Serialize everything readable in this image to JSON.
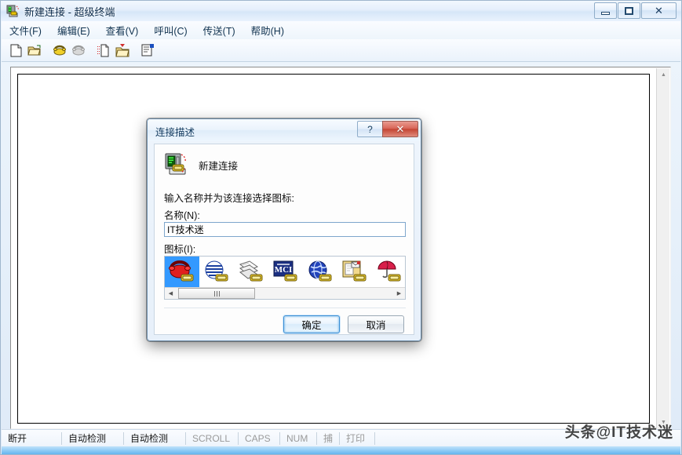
{
  "window": {
    "title": "新建连接 - 超级终端",
    "icon": "modem-phone-icon",
    "controls": {
      "minimize": "minimize-icon",
      "maximize": "maximize-icon",
      "close": "close-icon"
    }
  },
  "menubar": {
    "items": [
      {
        "label": "文件(F)",
        "name": "menu-file"
      },
      {
        "label": "编辑(E)",
        "name": "menu-edit"
      },
      {
        "label": "查看(V)",
        "name": "menu-view"
      },
      {
        "label": "呼叫(C)",
        "name": "menu-call"
      },
      {
        "label": "传送(T)",
        "name": "menu-transfer"
      },
      {
        "label": "帮助(H)",
        "name": "menu-help"
      }
    ]
  },
  "toolbar": {
    "buttons": [
      {
        "name": "new-connection-icon",
        "tip": "新建"
      },
      {
        "name": "open-folder-icon",
        "tip": "打开"
      },
      {
        "name": "call-phone-icon",
        "tip": "呼叫"
      },
      {
        "name": "hangup-phone-icon",
        "tip": "挂断"
      },
      {
        "name": "send-file-icon",
        "tip": "发送"
      },
      {
        "name": "receive-file-icon",
        "tip": "接收"
      },
      {
        "name": "properties-icon",
        "tip": "属性"
      }
    ]
  },
  "terminal": {
    "content": "",
    "scrollbar": {
      "up": "scroll-up-arrow",
      "down": "scroll-down-arrow"
    }
  },
  "statusbar": {
    "cells": [
      {
        "label": "断开",
        "dim": false,
        "name": "status-connection"
      },
      {
        "label": "自动检测",
        "dim": false,
        "name": "status-autodetect-1"
      },
      {
        "label": "自动检测",
        "dim": false,
        "name": "status-autodetect-2"
      },
      {
        "label": "SCROLL",
        "dim": true,
        "name": "status-scroll"
      },
      {
        "label": "CAPS",
        "dim": true,
        "name": "status-caps"
      },
      {
        "label": "NUM",
        "dim": true,
        "name": "status-num"
      },
      {
        "label": "捕",
        "dim": true,
        "name": "status-capture"
      },
      {
        "label": "打印",
        "dim": true,
        "name": "status-print"
      }
    ]
  },
  "watermark": {
    "text": "头条@IT技术迷"
  },
  "dialog": {
    "title": "连接描述",
    "help_glyph": "?",
    "close_glyph": "✕",
    "header_label": "新建连接",
    "header_icon": "modem-phone-icon",
    "hint": "输入名称并为该连接选择图标:",
    "name_label": "名称(N):",
    "name_value": "IT技术迷",
    "name_placeholder": "",
    "icon_label": "图标(I):",
    "icons": [
      {
        "name": "red-phone-icon",
        "selected": true
      },
      {
        "name": "striped-globe-icon",
        "selected": false
      },
      {
        "name": "documents-icon",
        "selected": false
      },
      {
        "name": "mci-icon",
        "selected": false
      },
      {
        "name": "blue-globe-icon",
        "selected": false
      },
      {
        "name": "notepad-mail-icon",
        "selected": false
      },
      {
        "name": "umbrella-icon",
        "selected": false
      }
    ],
    "scroll_left": "◀",
    "scroll_right": "▶",
    "ok_label": "确定",
    "cancel_label": "取消"
  },
  "colors": {
    "accent": "#3399ff",
    "close_button": "#c44634",
    "glow": "#63b6ef"
  }
}
